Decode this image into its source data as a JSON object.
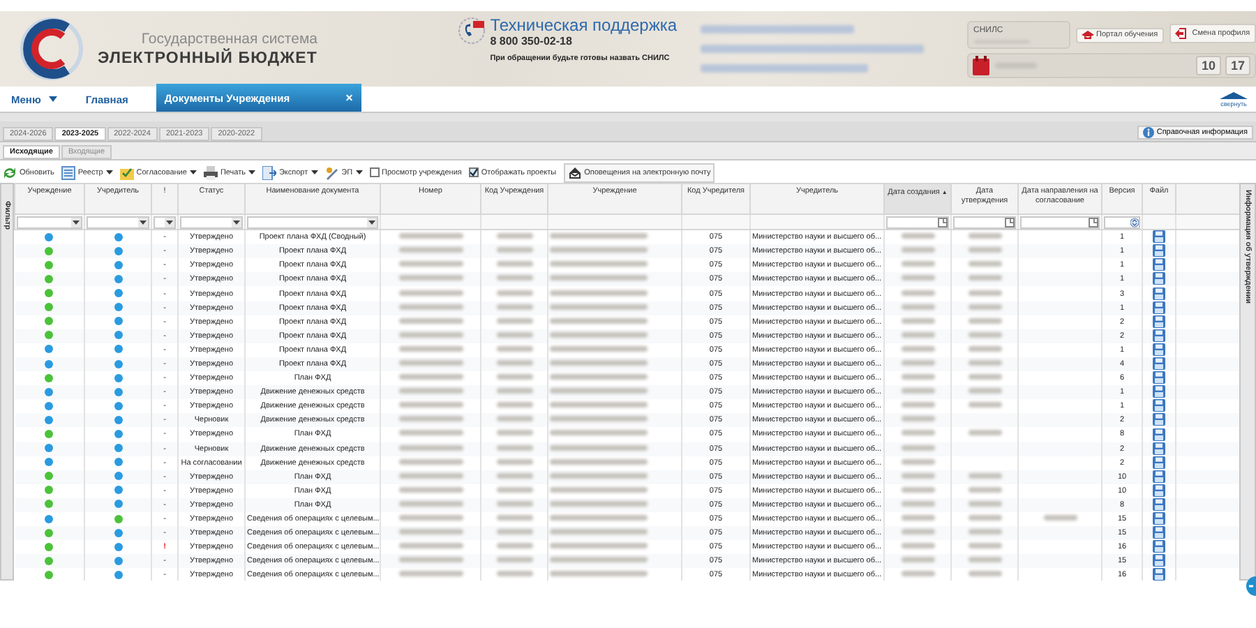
{
  "header": {
    "system_line": "Государственная система",
    "product": "ЭЛЕКТРОННЫЙ БЮДЖЕТ",
    "support_title": "Техническая поддержка",
    "support_phone": "8 800 350-02-18",
    "support_note": "При обращении будьте готовы назвать СНИЛС",
    "snils_label": "СНИЛС",
    "buttons": [
      {
        "label": "Портал обучения"
      },
      {
        "label": "Смена профиля"
      }
    ],
    "counters": [
      "10",
      "17"
    ],
    "collapse": "свернуть"
  },
  "nav": [
    {
      "label": "Меню",
      "kind": "dropdown",
      "selected": false
    },
    {
      "label": "Главная",
      "kind": "link",
      "selected": false
    },
    {
      "label": "Документы Учреждения",
      "kind": "closable",
      "selected": true,
      "close": "×"
    }
  ],
  "year_tabs": [
    {
      "label": "2024-2026",
      "selected": false
    },
    {
      "label": "2023-2025",
      "selected": true
    },
    {
      "label": "2022-2024",
      "selected": false
    },
    {
      "label": "2021-2023",
      "selected": false
    },
    {
      "label": "2020-2022",
      "selected": false
    }
  ],
  "info_button": "Справочная информация",
  "subtabs": [
    {
      "label": "Исходящие",
      "selected": true
    },
    {
      "label": "Входящие",
      "selected": false
    }
  ],
  "toolbar": [
    {
      "kind": "button",
      "label": "Обновить"
    },
    {
      "kind": "menu",
      "label": "Реестр"
    },
    {
      "kind": "menu",
      "label": "Согласование"
    },
    {
      "kind": "menu",
      "label": "Печать"
    },
    {
      "kind": "menu",
      "label": "Экспорт"
    },
    {
      "kind": "menu",
      "label": "ЭП"
    },
    {
      "kind": "checkbox",
      "label": "Просмотр учреждения",
      "checked": false
    },
    {
      "kind": "checkbox",
      "label": "Отображать проекты",
      "checked": true
    },
    {
      "kind": "button",
      "label": "Оповещения на электронную почту"
    }
  ],
  "filter_panel": "Фильтр",
  "info_panel": "Информация об утверждении",
  "table": {
    "columns": [
      {
        "label": "Учреждение",
        "kind": "select",
        "sorted": false
      },
      {
        "label": "Учредитель",
        "kind": "select",
        "sorted": false
      },
      {
        "label": "!",
        "kind": "select",
        "sorted": false
      },
      {
        "label": "Статус",
        "kind": "select",
        "sorted": false
      },
      {
        "label": "Наименование документа",
        "kind": "select",
        "sorted": false
      },
      {
        "label": "Номер",
        "kind": "plain",
        "sorted": false
      },
      {
        "label": "Код Учреждения",
        "kind": "plain",
        "sorted": false
      },
      {
        "label": "Учреждение",
        "kind": "plain",
        "sorted": false
      },
      {
        "label": "Код Учредителя",
        "kind": "plain",
        "sorted": false
      },
      {
        "label": "Учредитель",
        "kind": "plain",
        "sorted": false
      },
      {
        "label": "Дата создания",
        "kind": "date",
        "sorted": true,
        "sort_mark": "▲"
      },
      {
        "label": "Дата утверждения",
        "kind": "date",
        "sorted": false
      },
      {
        "label": "Дата направления на согласование",
        "kind": "date",
        "sorted": false
      },
      {
        "label": "Версия",
        "kind": "spin",
        "sorted": false
      },
      {
        "label": "Файл",
        "kind": "plain",
        "sorted": false
      }
    ],
    "rows": [
      {
        "org_marker": {
          "color": "#2a9be0"
        },
        "founder_marker": {
          "color": "#2a9be0"
        },
        "flag": "-",
        "status": "Утверждено",
        "name": "Проект плана ФХД (Сводный)",
        "founder_code": "075",
        "founder": "Министерство науки и высшего об...",
        "approved_blurred": true,
        "sent_blurred": false,
        "version": "1"
      },
      {
        "org_marker": {
          "color": "#4cc23a"
        },
        "founder_marker": {
          "color": "#2a9be0"
        },
        "flag": "-",
        "status": "Утверждено",
        "name": "Проект плана ФХД",
        "founder_code": "075",
        "founder": "Министерство науки и высшего об...",
        "approved_blurred": true,
        "sent_blurred": false,
        "version": "1"
      },
      {
        "org_marker": {
          "color": "#4cc23a"
        },
        "founder_marker": {
          "color": "#2a9be0"
        },
        "flag": "-",
        "status": "Утверждено",
        "name": "Проект плана ФХД",
        "founder_code": "075",
        "founder": "Министерство науки и высшего об...",
        "approved_blurred": true,
        "sent_blurred": false,
        "version": "1"
      },
      {
        "org_marker": {
          "color": "#4cc23a"
        },
        "founder_marker": {
          "color": "#2a9be0"
        },
        "flag": "-",
        "status": "Утверждено",
        "name": "Проект плана ФХД",
        "founder_code": "075",
        "founder": "Министерство науки и высшего об...",
        "approved_blurred": true,
        "sent_blurred": false,
        "version": "1"
      },
      {
        "org_marker": {
          "color": "#4cc23a"
        },
        "founder_marker": {
          "color": "#2a9be0"
        },
        "flag": "-",
        "status": "Утверждено",
        "name": "Проект плана ФХД",
        "founder_code": "075",
        "founder": "Министерство науки и высшего об...",
        "approved_blurred": true,
        "sent_blurred": false,
        "version": "3"
      },
      {
        "org_marker": {
          "color": "#4cc23a"
        },
        "founder_marker": {
          "color": "#2a9be0"
        },
        "flag": "-",
        "status": "Утверждено",
        "name": "Проект плана ФХД",
        "founder_code": "075",
        "founder": "Министерство науки и высшего об...",
        "approved_blurred": true,
        "sent_blurred": false,
        "version": "1"
      },
      {
        "org_marker": {
          "color": "#4cc23a"
        },
        "founder_marker": {
          "color": "#2a9be0"
        },
        "flag": "-",
        "status": "Утверждено",
        "name": "Проект плана ФХД",
        "founder_code": "075",
        "founder": "Министерство науки и высшего об...",
        "approved_blurred": true,
        "sent_blurred": false,
        "version": "2"
      },
      {
        "org_marker": {
          "color": "#4cc23a"
        },
        "founder_marker": {
          "color": "#2a9be0"
        },
        "flag": "-",
        "status": "Утверждено",
        "name": "Проект плана ФХД",
        "founder_code": "075",
        "founder": "Министерство науки и высшего об...",
        "approved_blurred": true,
        "sent_blurred": false,
        "version": "2"
      },
      {
        "org_marker": {
          "color": "#2a9be0"
        },
        "founder_marker": {
          "color": "#2a9be0"
        },
        "flag": "-",
        "status": "Утверждено",
        "name": "Проект плана ФХД",
        "founder_code": "075",
        "founder": "Министерство науки и высшего об...",
        "approved_blurred": true,
        "sent_blurred": false,
        "version": "1"
      },
      {
        "org_marker": {
          "color": "#2a9be0"
        },
        "founder_marker": {
          "color": "#2a9be0"
        },
        "flag": "-",
        "status": "Утверждено",
        "name": "Проект плана ФХД",
        "founder_code": "075",
        "founder": "Министерство науки и высшего об...",
        "approved_blurred": true,
        "sent_blurred": false,
        "version": "4"
      },
      {
        "org_marker": {
          "color": "#4cc23a"
        },
        "founder_marker": {
          "color": "#2a9be0"
        },
        "flag": "-",
        "status": "Утверждено",
        "name": "План ФХД",
        "founder_code": "075",
        "founder": "Министерство науки и высшего об...",
        "approved_blurred": true,
        "sent_blurred": false,
        "version": "6"
      },
      {
        "org_marker": {
          "color": "#2a9be0"
        },
        "founder_marker": {
          "color": "#2a9be0"
        },
        "flag": "-",
        "status": "Утверждено",
        "name": "Движение денежных средств",
        "founder_code": "075",
        "founder": "Министерство науки и высшего об...",
        "approved_blurred": true,
        "sent_blurred": false,
        "version": "1"
      },
      {
        "org_marker": {
          "color": "#2a9be0"
        },
        "founder_marker": {
          "color": "#2a9be0"
        },
        "flag": "-",
        "status": "Утверждено",
        "name": "Движение денежных средств",
        "founder_code": "075",
        "founder": "Министерство науки и высшего об...",
        "approved_blurred": true,
        "sent_blurred": false,
        "version": "1"
      },
      {
        "org_marker": {
          "color": "#2a9be0"
        },
        "founder_marker": {
          "color": "#2a9be0"
        },
        "flag": "-",
        "status": "Черновик",
        "name": "Движение денежных средств",
        "founder_code": "075",
        "founder": "Министерство науки и высшего об...",
        "approved_blurred": false,
        "sent_blurred": false,
        "version": "2"
      },
      {
        "org_marker": {
          "color": "#4cc23a"
        },
        "founder_marker": {
          "color": "#2a9be0"
        },
        "flag": "-",
        "status": "Утверждено",
        "name": "План ФХД",
        "founder_code": "075",
        "founder": "Министерство науки и высшего об...",
        "approved_blurred": true,
        "sent_blurred": false,
        "version": "8"
      },
      {
        "org_marker": {
          "color": "#2a9be0"
        },
        "founder_marker": {
          "color": "#2a9be0"
        },
        "flag": "-",
        "status": "Черновик",
        "name": "Движение денежных средств",
        "founder_code": "075",
        "founder": "Министерство науки и высшего об...",
        "approved_blurred": false,
        "sent_blurred": false,
        "version": "2"
      },
      {
        "org_marker": {
          "color": "#2a9be0"
        },
        "founder_marker": {
          "color": "#2a9be0"
        },
        "flag": "-",
        "status": "На согласовании",
        "name": "Движение денежных средств",
        "founder_code": "075",
        "founder": "Министерство науки и высшего об...",
        "approved_blurred": false,
        "sent_blurred": false,
        "version": "2"
      },
      {
        "org_marker": {
          "color": "#4cc23a"
        },
        "founder_marker": {
          "color": "#2a9be0"
        },
        "flag": "-",
        "status": "Утверждено",
        "name": "План ФХД",
        "founder_code": "075",
        "founder": "Министерство науки и высшего об...",
        "approved_blurred": true,
        "sent_blurred": false,
        "version": "10"
      },
      {
        "org_marker": {
          "color": "#4cc23a"
        },
        "founder_marker": {
          "color": "#2a9be0"
        },
        "flag": "-",
        "status": "Утверждено",
        "name": "План ФХД",
        "founder_code": "075",
        "founder": "Министерство науки и высшего об...",
        "approved_blurred": true,
        "sent_blurred": false,
        "version": "10"
      },
      {
        "org_marker": {
          "color": "#4cc23a"
        },
        "founder_marker": {
          "color": "#2a9be0"
        },
        "flag": "-",
        "status": "Утверждено",
        "name": "План ФХД",
        "founder_code": "075",
        "founder": "Министерство науки и высшего об...",
        "approved_blurred": true,
        "sent_blurred": false,
        "version": "8"
      },
      {
        "org_marker": {
          "color": "#2a9be0"
        },
        "founder_marker": {
          "color": "#4cc23a"
        },
        "flag": "-",
        "status": "Утверждено",
        "name": "Сведения об операциях с целевым...",
        "founder_code": "075",
        "founder": "Министерство науки и высшего об...",
        "approved_blurred": true,
        "sent_blurred": true,
        "version": "15"
      },
      {
        "org_marker": {
          "color": "#4cc23a"
        },
        "founder_marker": {
          "color": "#2a9be0"
        },
        "flag": "-",
        "status": "Утверждено",
        "name": "Сведения об операциях с целевым...",
        "founder_code": "075",
        "founder": "Министерство науки и высшего об...",
        "approved_blurred": true,
        "sent_blurred": false,
        "version": "15"
      },
      {
        "org_marker": {
          "color": "#4cc23a"
        },
        "founder_marker": {
          "color": "#2a9be0"
        },
        "flag": "!",
        "status": "Утверждено",
        "name": "Сведения об операциях с целевым...",
        "founder_code": "075",
        "founder": "Министерство науки и высшего об...",
        "approved_blurred": true,
        "sent_blurred": false,
        "version": "16"
      },
      {
        "org_marker": {
          "color": "#4cc23a"
        },
        "founder_marker": {
          "color": "#2a9be0"
        },
        "flag": "-",
        "status": "Утверждено",
        "name": "Сведения об операциях с целевым...",
        "founder_code": "075",
        "founder": "Министерство науки и высшего об...",
        "approved_blurred": true,
        "sent_blurred": false,
        "version": "15"
      },
      {
        "org_marker": {
          "color": "#4cc23a"
        },
        "founder_marker": {
          "color": "#2a9be0"
        },
        "flag": "-",
        "status": "Утверждено",
        "name": "Сведения об операциях с целевым...",
        "founder_code": "075",
        "founder": "Министерство науки и высшего об...",
        "approved_blurred": true,
        "sent_blurred": false,
        "version": "16"
      }
    ]
  }
}
